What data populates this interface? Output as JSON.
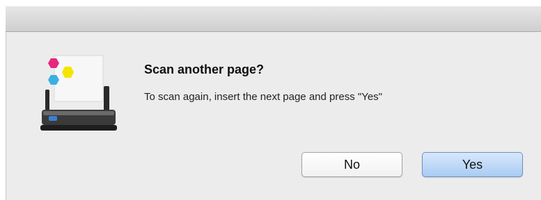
{
  "dialog": {
    "title": "Scan another page?",
    "message": "To scan again, insert the next page and press \"Yes\"",
    "icon": "scanner-icon"
  },
  "buttons": {
    "no_label": "No",
    "yes_label": "Yes"
  },
  "colors": {
    "magenta": "#e8267e",
    "yellow": "#f4e500",
    "cyan": "#3ab0e0",
    "default_button": "#a9cbf3"
  }
}
